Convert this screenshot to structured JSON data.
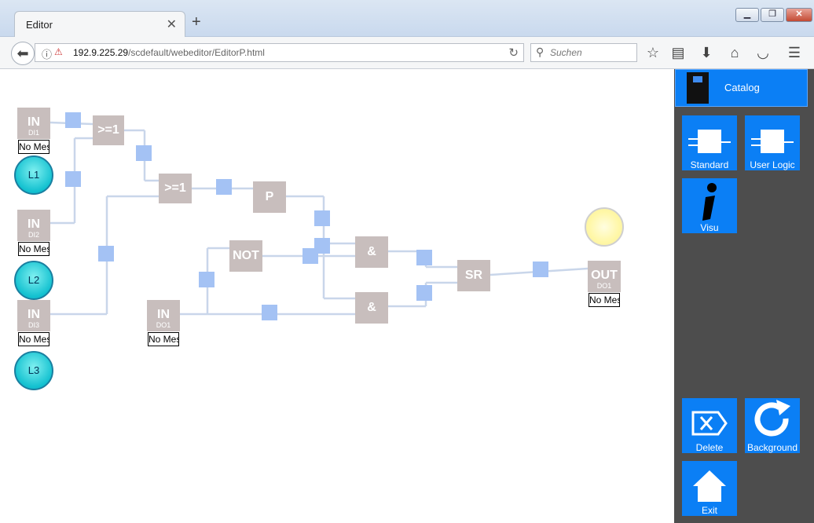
{
  "browser": {
    "tab_title": "Editor",
    "url_host": "192.9.225.29",
    "url_path": "/scdefault/webeditor/EditorP.html",
    "search_placeholder": "Suchen"
  },
  "blocks": {
    "in1": {
      "title": "IN",
      "sub": "DI1"
    },
    "in2": {
      "title": "IN",
      "sub": "DI2"
    },
    "in3": {
      "title": "IN",
      "sub": "DI3"
    },
    "in4": {
      "title": "IN",
      "sub": "DO1"
    },
    "or1": {
      "title": ">=1"
    },
    "or2": {
      "title": ">=1"
    },
    "p": {
      "title": "P"
    },
    "not": {
      "title": "NOT"
    },
    "and1": {
      "title": "&"
    },
    "and2": {
      "title": "&"
    },
    "sr": {
      "title": "SR"
    },
    "out": {
      "title": "OUT",
      "sub": "DO1"
    }
  },
  "messages": {
    "in1": "No Mes",
    "in2": "No Mes",
    "in3": "No Mes",
    "in4": "No Mes",
    "out": "No Mes"
  },
  "leds": {
    "l1": "L1",
    "l2": "L2",
    "l3": "L3"
  },
  "panel": {
    "catalog_label": "Catalog",
    "standard_label": "Standard",
    "userlogic_label": "User Logic",
    "visu_label": "Visu",
    "delete_label": "Delete",
    "background_label": "Background",
    "exit_label": "Exit"
  },
  "colors": {
    "accent": "#0b7ff5",
    "panel_bg": "#4d4d4d",
    "block": "#c8bebd",
    "connector": "#a4c2f4",
    "led": "#13c1d0"
  }
}
